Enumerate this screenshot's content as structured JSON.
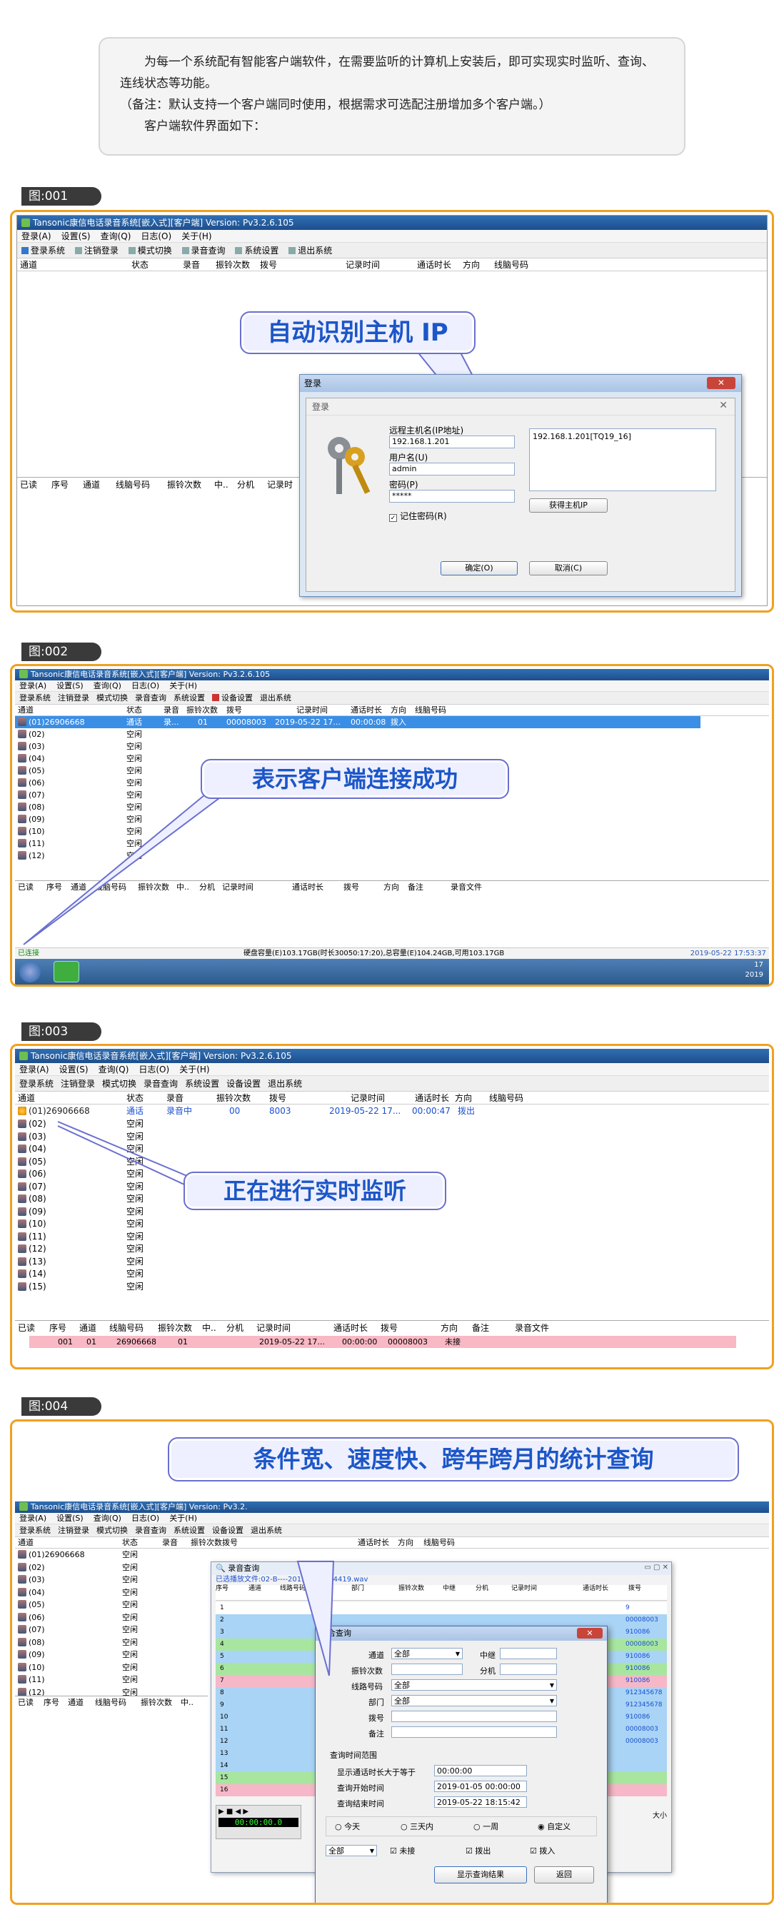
{
  "intro": {
    "line1": "为每一个系统配有智能客户端软件，在需要监听的计算机上安装后，即可实现实时监听、查询、连线状态等功能。",
    "line2": "（备注：默认支持一个客户端同时使用，根据需求可选配注册增加多个客户端。）",
    "line3": "客户端软件界面如下："
  },
  "figures": [
    {
      "tag": "图:001",
      "callout": "自动识别主机 IP"
    },
    {
      "tag": "图:002",
      "callout": "表示客户端连接成功"
    },
    {
      "tag": "图:003",
      "callout": "正在进行实时监听"
    },
    {
      "tag": "图:004",
      "callout": "条件宽、速度快、跨年跨月的统计查询"
    }
  ],
  "app": {
    "title_full": "Tansonic康信电话录音系统[嵌入式][客户端] Version: Pv3.2.6.105",
    "title_short": "Tansonic康信电话录音系统[嵌入式][客户端] Version: Pv3.2.",
    "menu": [
      "登录(A)",
      "设置(S)",
      "查询(Q)",
      "日志(O)",
      "关于(H)"
    ],
    "toolbar": [
      "登录系统",
      "注销登录",
      "模式切换",
      "录音查询",
      "系统设置",
      "设备设置",
      "退出系统"
    ],
    "columns": [
      "通道",
      "状态",
      "录音",
      "振铃次数",
      "拨号",
      "记录时间",
      "通话时长",
      "方向",
      "线脑号码"
    ],
    "bottom_columns": [
      "已读",
      "序号",
      "通道",
      "线脑号码",
      "振铃次数",
      "中..",
      "分机",
      "记录时间",
      "通话时长",
      "拨号",
      "方向",
      "备注",
      "录音文件"
    ]
  },
  "fig1": {
    "bottom_cols": [
      "已读",
      "序号",
      "通道",
      "线脑号码",
      "振铃次数",
      "中..",
      "分机",
      "记录时"
    ],
    "outer_title": "登录",
    "inner_title": "登录",
    "host_label": "远程主机名(IP地址)",
    "host_value": "192.168.1.201",
    "user_label": "用户名(U)",
    "user_value": "admin",
    "pwd_label": "密码(P)",
    "pwd_value": "*****",
    "remember": "记住密码(R)",
    "list_item": "192.168.1.201[TQ19_16]",
    "get_ip": "获得主机IP",
    "ok": "确定(O)",
    "cancel": "取消(C)"
  },
  "fig2": {
    "row1": {
      "ch": "(01)26906668",
      "status": "通话",
      "rec": "录...",
      "ring": "01",
      "dial": "00008003",
      "time": "2019-05-22 17...",
      "dur": "00:00:08",
      "dir": "拨入"
    },
    "rows": [
      "(02)",
      "(03)",
      "(04)",
      "(05)",
      "(06)",
      "(07)",
      "(08)",
      "(09)",
      "(10)",
      "(11)",
      "(12)"
    ],
    "idle": "空闲",
    "status_left": "已连接",
    "status_mid": "硬盘容量(E)103.17GB(时长30050:17:20),总容量(E)104.24GB,可用103.17GB",
    "status_right": "2019-05-22 17:53:37",
    "tray_time": "17",
    "tray_year": "2019"
  },
  "fig3": {
    "row1": {
      "ch": "(01)26906668",
      "status": "通话",
      "rec": "录音中",
      "ring": "00",
      "dial": "8003",
      "time": "2019-05-22 17...",
      "dur": "00:00:47",
      "dir": "拨出"
    },
    "rows": [
      "(02)",
      "(03)",
      "(04)",
      "(05)",
      "(06)",
      "(07)",
      "(08)",
      "(09)",
      "(10)",
      "(11)",
      "(12)",
      "(13)",
      "(14)",
      "(15)"
    ],
    "idle": "空闲",
    "log": {
      "seq": "001",
      "ch": "01",
      "line": "26906668",
      "ring": "01",
      "time": "2019-05-22 17...",
      "dur": "00:00:00",
      "dial": "00008003",
      "dir": "未接"
    }
  },
  "fig4": {
    "rows": [
      "(01)26906668",
      "(02)",
      "(03)",
      "(04)",
      "(05)",
      "(06)",
      "(07)",
      "(08)",
      "(09)",
      "(10)",
      "(11)",
      "(12)"
    ],
    "idle": "空闲",
    "rec_window_title": "录音查询",
    "rec_file": "已选播放文件:02-B----20190522164419.wav",
    "rec_cols": [
      "序号",
      "通道",
      "线路号码",
      "部门",
      "振铃次数",
      "中继",
      "分机",
      "记录时间",
      "通话时长",
      "拨号"
    ],
    "right_values": [
      "9",
      "00008003",
      "910086",
      "00008003",
      "910086",
      "910086",
      "910086",
      "912345678",
      "912345678",
      "910086",
      "00008003",
      "00008003"
    ],
    "row_nums": [
      "1",
      "2",
      "3",
      "4",
      "5",
      "6",
      "7",
      "8",
      "9",
      "10",
      "11",
      "12",
      "13",
      "14",
      "15",
      "16"
    ],
    "dlg_title": "综合查询",
    "channel_label": "通道",
    "channel_value": "全部",
    "trunk_label": "中继",
    "ring_label": "振铃次数",
    "ext_label": "分机",
    "line_label": "线路号码",
    "line_value": "全部",
    "dept_label": "部门",
    "dept_value": "全部",
    "dial_label": "拨号",
    "note_label": "备注",
    "range_label": "查询时间范围",
    "dur_label": "显示通话时长大于等于",
    "dur_value": "00:00:00",
    "start_label": "查询开始时间",
    "start_value": "2019-01-05 00:00:00",
    "end_label": "查询结束时间",
    "end_value": "2019-05-22 18:15:42",
    "radios": [
      "今天",
      "三天内",
      "一周",
      "自定义"
    ],
    "scope": "全部",
    "checks": [
      "未接",
      "拨出",
      "拨入"
    ],
    "show_btn": "显示查询结果",
    "back_btn": "返回",
    "timer": "00:00:00.0",
    "side_small": "大小"
  }
}
